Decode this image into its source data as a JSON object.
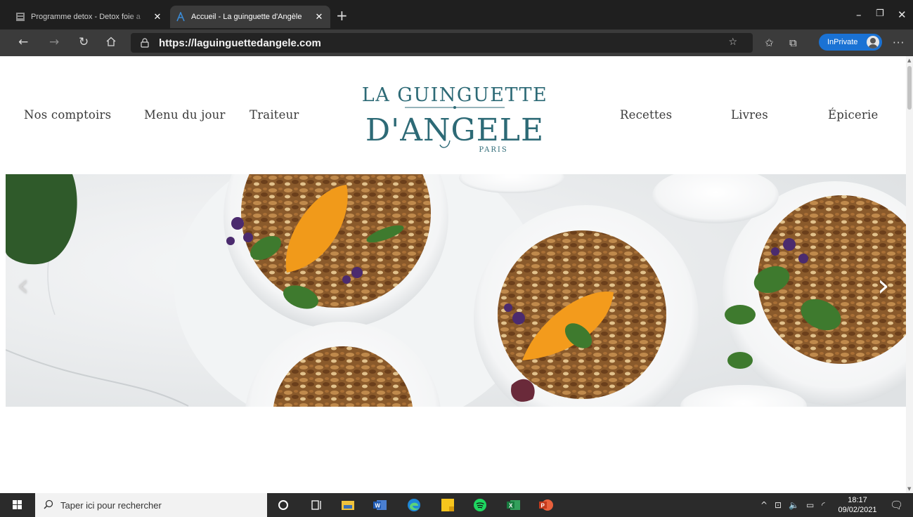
{
  "browser": {
    "tabs": [
      {
        "title": "Programme detox - Detox foie a",
        "close": "✕",
        "active": false
      },
      {
        "title": "Accueil - La guinguette d'Angèle",
        "close": "✕",
        "active": true
      }
    ],
    "new_tab": "+",
    "url": "https://laguinguettedangele.com",
    "inprivate_label": "InPrivate",
    "more": "···",
    "icons": [
      "back-icon",
      "forward-icon",
      "refresh-icon",
      "home-icon",
      "lock-icon",
      "read-aloud-icon",
      "favorites-icon",
      "collections-icon"
    ]
  },
  "site": {
    "nav_left": [
      "Nos comptoirs",
      "Menu du jour",
      "Traiteur"
    ],
    "nav_right": [
      "Recettes",
      "Livres",
      "Épicerie"
    ],
    "logo": {
      "line1": "LA GUINGUETTE",
      "line2": "D'ANGELE",
      "line3": "PARIS",
      "color": "#2d6a76"
    },
    "carousel": {
      "prev": "‹",
      "next": "›"
    }
  },
  "taskbar": {
    "search_placeholder": "Taper ici pour rechercher",
    "time": "18:17",
    "date": "09/02/2021",
    "apps": [
      "cortana-icon",
      "task-view-icon",
      "file-explorer-icon",
      "word-icon",
      "edge-icon",
      "sticky-notes-icon",
      "spotify-icon",
      "excel-icon",
      "powerpoint-icon"
    ]
  },
  "colors": {
    "accent": "#1a72d4",
    "chrome_dark": "#1f1f1f",
    "chrome_mid": "#3b3b3b",
    "logo": "#2d6a76"
  }
}
